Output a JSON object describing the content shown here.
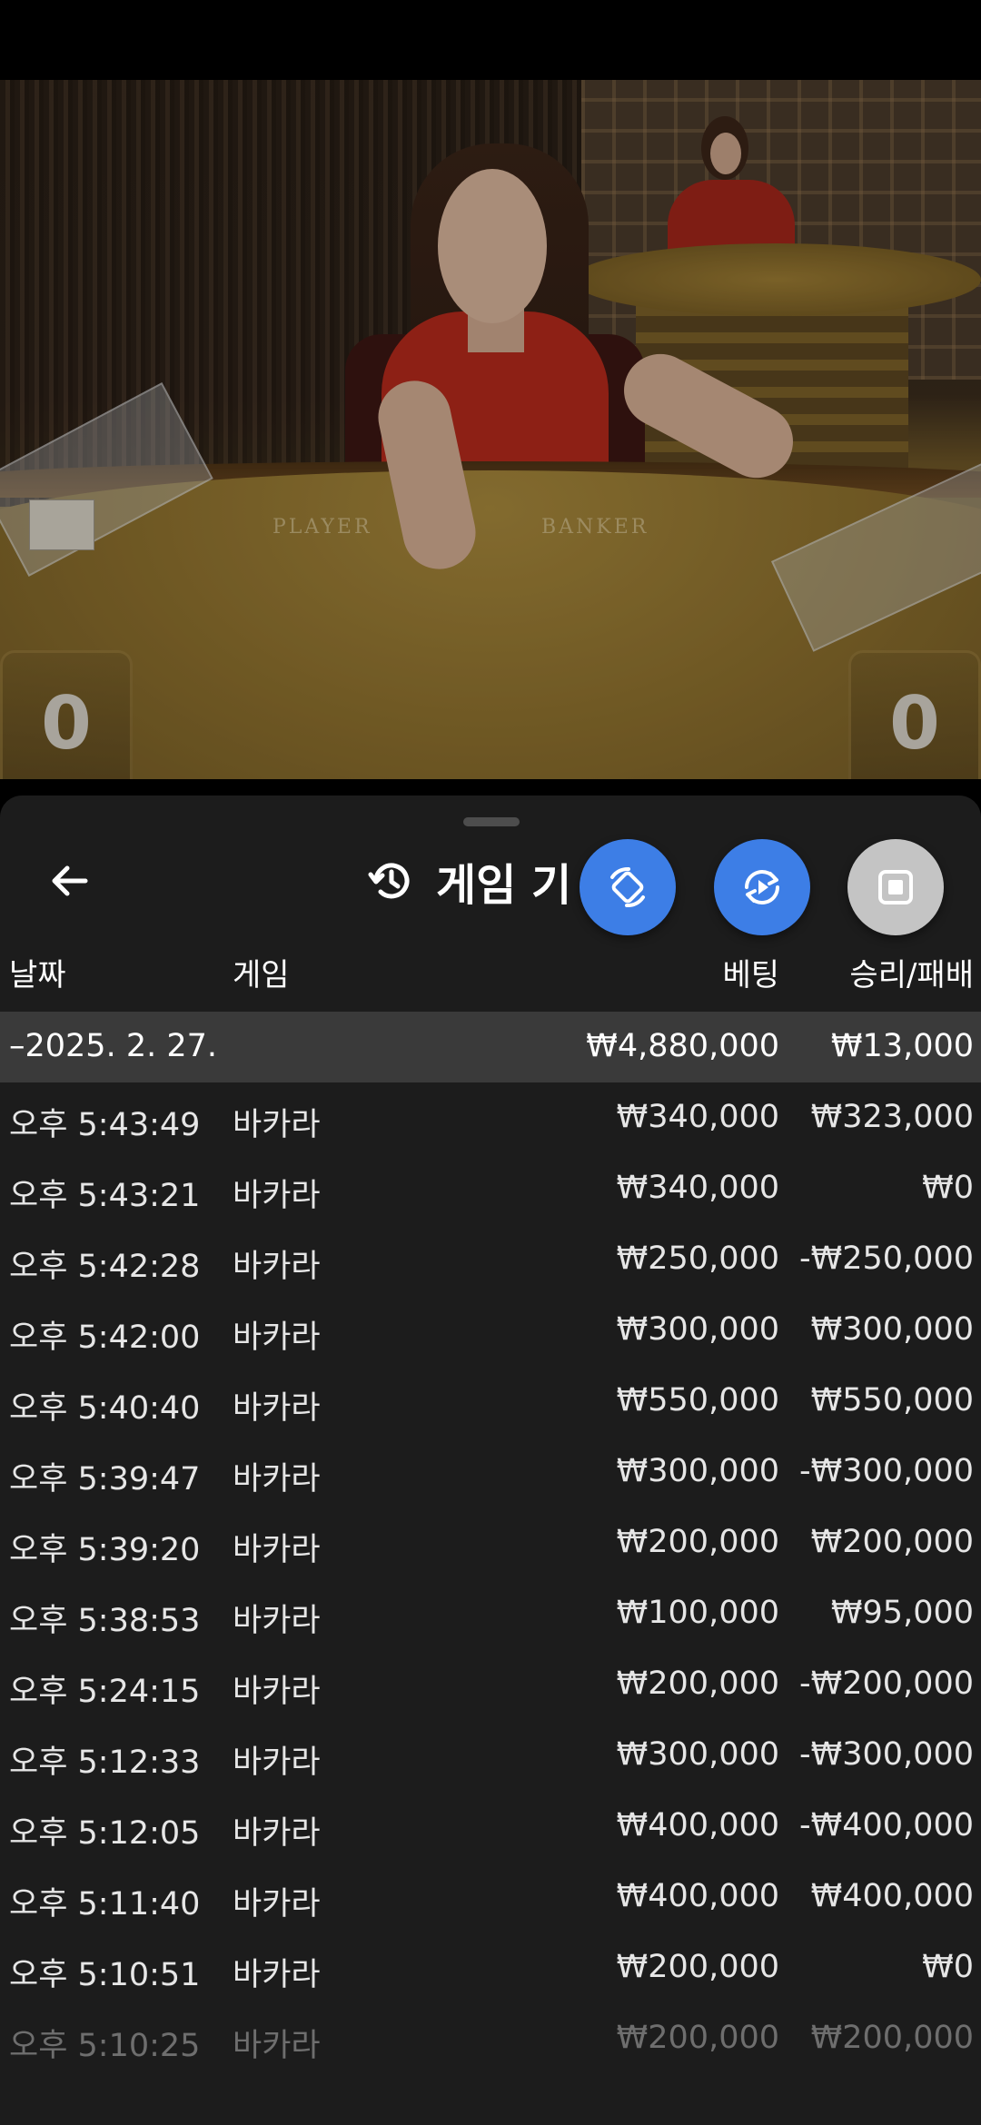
{
  "video": {
    "table_labels": [
      "PLAYER",
      "BANKER"
    ],
    "score_left": "0",
    "score_right": "0"
  },
  "sheet": {
    "title": "게임 기록",
    "title_visible": "게임 기",
    "icons": {
      "back": "back-arrow-icon",
      "history": "history-icon",
      "fab1": "rotate-screen-icon",
      "fab2": "replay-icon",
      "fab3": "stop-icon"
    },
    "colors": {
      "accent": "#3d7ee6",
      "sheet_bg": "#1c1c1c",
      "group_bg": "#3a3a3a"
    },
    "columns": {
      "date": "날짜",
      "game": "게임",
      "bet": "베팅",
      "win_loss": "승리/패배"
    },
    "group": {
      "date": "–2025. 2. 27.",
      "bet": "₩4,880,000",
      "win_loss": "₩13,000"
    },
    "rows": [
      {
        "time": "오후 5:43:49",
        "game": "바카라",
        "bet": "₩340,000",
        "win_loss": "₩323,000"
      },
      {
        "time": "오후 5:43:21",
        "game": "바카라",
        "bet": "₩340,000",
        "win_loss": "₩0"
      },
      {
        "time": "오후 5:42:28",
        "game": "바카라",
        "bet": "₩250,000",
        "win_loss": "-₩250,000"
      },
      {
        "time": "오후 5:42:00",
        "game": "바카라",
        "bet": "₩300,000",
        "win_loss": "₩300,000"
      },
      {
        "time": "오후 5:40:40",
        "game": "바카라",
        "bet": "₩550,000",
        "win_loss": "₩550,000"
      },
      {
        "time": "오후 5:39:47",
        "game": "바카라",
        "bet": "₩300,000",
        "win_loss": "-₩300,000"
      },
      {
        "time": "오후 5:39:20",
        "game": "바카라",
        "bet": "₩200,000",
        "win_loss": "₩200,000"
      },
      {
        "time": "오후 5:38:53",
        "game": "바카라",
        "bet": "₩100,000",
        "win_loss": "₩95,000"
      },
      {
        "time": "오후 5:24:15",
        "game": "바카라",
        "bet": "₩200,000",
        "win_loss": "-₩200,000"
      },
      {
        "time": "오후 5:12:33",
        "game": "바카라",
        "bet": "₩300,000",
        "win_loss": "-₩300,000"
      },
      {
        "time": "오후 5:12:05",
        "game": "바카라",
        "bet": "₩400,000",
        "win_loss": "-₩400,000"
      },
      {
        "time": "오후 5:11:40",
        "game": "바카라",
        "bet": "₩400,000",
        "win_loss": "₩400,000"
      },
      {
        "time": "오후 5:10:51",
        "game": "바카라",
        "bet": "₩200,000",
        "win_loss": "₩0"
      },
      {
        "time": "오후 5:10:25",
        "game": "바카라",
        "bet": "₩200,000",
        "win_loss": "₩200,000"
      }
    ]
  }
}
